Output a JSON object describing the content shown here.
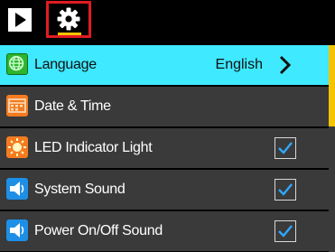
{
  "top_tabs": [
    {
      "name": "playback",
      "icon": "play-icon"
    },
    {
      "name": "settings",
      "icon": "gear-icon",
      "selected": true
    }
  ],
  "settings_list": [
    {
      "label": "Language",
      "value": "English",
      "control": "chevron-right-icon",
      "icon": "globe-icon",
      "selected": true
    },
    {
      "label": "Date & Time",
      "icon": "calendar-icon"
    },
    {
      "label": "LED Indicator Light",
      "icon": "led-light-icon",
      "checked": true
    },
    {
      "label": "System Sound",
      "icon": "speaker-icon",
      "checked": true
    },
    {
      "label": "Power On/Off Sound",
      "icon": "speaker-icon",
      "checked": true
    }
  ],
  "colors": {
    "selected_row": "#3fe9ff",
    "row": "#3a3a3a",
    "tab_border": "#e11b22",
    "accent": "#f5c400",
    "checkmark": "#2fa8ff"
  }
}
